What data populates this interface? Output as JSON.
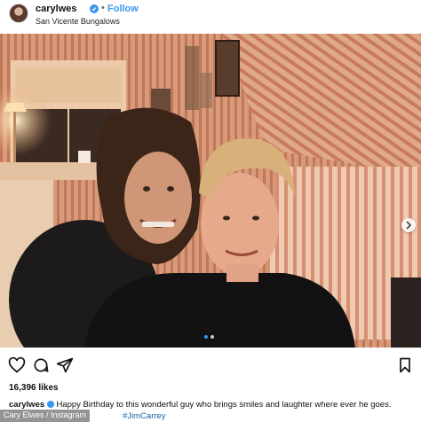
{
  "header": {
    "username": "carylwes",
    "separator": "•",
    "follow_label": "Follow",
    "location": "San Vicente Bungalows"
  },
  "photo": {
    "carousel_index": 1,
    "carousel_count": 2
  },
  "post": {
    "likes": "16,396 likes",
    "caption_user": "carylwes",
    "caption_text": "Happy Birthday to this wonderful guy who brings smiles and laughter where ever he goes.",
    "caption_hashtag": "#JimCarrey"
  },
  "credit": "Cary Elwes / Instagram",
  "colors": {
    "accent": "#3897f0",
    "hashtag": "#1b5fa8"
  },
  "icons": [
    "verified-icon",
    "chevron-right-icon",
    "heart-icon",
    "comment-icon",
    "share-icon",
    "bookmark-icon"
  ]
}
